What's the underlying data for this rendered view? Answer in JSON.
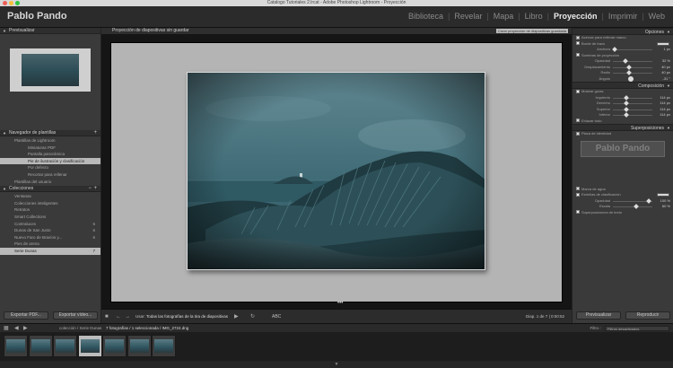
{
  "window": {
    "title": "Catalogo Tutoriales 2.lrcat - Adobe Photoshop Lightroom - Proyección",
    "close_color": "#ee5f57",
    "min_color": "#f6be3b",
    "max_color": "#30c441"
  },
  "identity": "Pablo Pando",
  "modules": [
    {
      "label": "Biblioteca",
      "active": false
    },
    {
      "label": "Revelar",
      "active": false
    },
    {
      "label": "Mapa",
      "active": false
    },
    {
      "label": "Libro",
      "active": false
    },
    {
      "label": "Proyección",
      "active": true
    },
    {
      "label": "Imprimir",
      "active": false
    },
    {
      "label": "Web",
      "active": false
    }
  ],
  "left": {
    "preview_title": "Previsualizar",
    "templates_title": "Navegador de plantillas",
    "templates": [
      {
        "label": "Plantillas de Lightroom",
        "level": 0,
        "selected": false
      },
      {
        "label": "Miniaturas PDF",
        "level": 2,
        "selected": false
      },
      {
        "label": "Pantalla panorámica",
        "level": 2,
        "selected": false
      },
      {
        "label": "Pie de ilustración y clasificación",
        "level": 2,
        "selected": true
      },
      {
        "label": "Por defecto",
        "level": 2,
        "selected": false
      },
      {
        "label": "Recortar para rellenar",
        "level": 2,
        "selected": false
      },
      {
        "label": "Plantillas del usuario",
        "level": 0,
        "selected": false
      }
    ],
    "collections_title": "Colecciones",
    "collections": [
      {
        "label": "Ventanas",
        "count": "",
        "selected": false
      },
      {
        "label": "Colecciones inteligentes",
        "count": "",
        "selected": false
      },
      {
        "label": "Retratos",
        "count": "",
        "selected": false
      },
      {
        "label": "Smart Collections",
        "count": "",
        "selected": false
      },
      {
        "label": "Contraluces",
        "count": "6",
        "selected": false
      },
      {
        "label": "Dunas de San Justo",
        "count": "6",
        "selected": false
      },
      {
        "label": "Nuevo Faro de Bravíos y...",
        "count": "6",
        "selected": false
      },
      {
        "label": "Pies de arena",
        "count": "",
        "selected": false
      },
      {
        "label": "Serie Dunas",
        "count": "7",
        "selected": true
      }
    ],
    "export_pdf": "Exportar PDF...",
    "export_video": "Exportar vídeo..."
  },
  "main": {
    "header": "Proyección de diapositivas sin guardar",
    "header_right": "Crear proyección de diapositivas guardada",
    "dots": "•••",
    "toolbar": {
      "use_label": "Usar:",
      "use_value": "Todas las fotografías de la tira de diapositivas",
      "abc": "ABC",
      "slide_info": "Diap. 1 de 7 | 0:00:52"
    }
  },
  "right": {
    "options_title": "Opciones",
    "options_rows": [
      {
        "type": "check",
        "label": "Acercar para rellenar marco",
        "checked": false
      },
      {
        "type": "check",
        "label": "Borde de trazo",
        "checked": true,
        "swatch": "#d8d8d8"
      },
      {
        "type": "slider",
        "label": "Anchura",
        "value": "1 px",
        "pos": 0.05
      },
      {
        "type": "check",
        "label": "Sombras de proyección",
        "checked": true
      },
      {
        "type": "slider",
        "label": "Opacidad",
        "value": "32 %",
        "pos": 0.32
      },
      {
        "type": "slider",
        "label": "Desplazamiento",
        "value": "40 px",
        "pos": 0.4
      },
      {
        "type": "slider",
        "label": "Radio",
        "value": "40 px",
        "pos": 0.4
      },
      {
        "type": "dial",
        "label": "Ángulo",
        "value": "-31 °"
      }
    ],
    "layout_title": "Composición",
    "layout_rows": [
      {
        "type": "check",
        "label": "Mostrar guías",
        "checked": true
      },
      {
        "type": "slider",
        "label": "Izquierdo",
        "value": "114 px",
        "pos": 0.35
      },
      {
        "type": "slider",
        "label": "Derecho",
        "value": "114 px",
        "pos": 0.35
      },
      {
        "type": "slider",
        "label": "Superior",
        "value": "114 px",
        "pos": 0.35
      },
      {
        "type": "slider",
        "label": "Inferior",
        "value": "114 px",
        "pos": 0.35
      },
      {
        "type": "check",
        "label": "Enlazar todo",
        "checked": false
      }
    ],
    "overlays_title": "Superposiciones",
    "identity_check": "Placa de identidad",
    "identity_plate_text": "Pablo Pando",
    "overlay_rows": [
      {
        "type": "check",
        "label": "Marca de agua",
        "checked": false
      },
      {
        "type": "check",
        "label": "Estrellas de clasificación",
        "checked": true,
        "swatch": "#d8d8d8"
      },
      {
        "type": "slider",
        "label": "Opacidad",
        "value": "100 %",
        "pos": 0.9
      },
      {
        "type": "slider",
        "label": "Escala",
        "value": "60 %",
        "pos": 0.6
      },
      {
        "type": "check",
        "label": "Superposiciones de texto",
        "checked": true
      }
    ],
    "preview_button": "Previsualizar",
    "play_button": "Reproducir"
  },
  "filmbar": {
    "source": "colección / Serie Dunas",
    "count": "7 fotografías / 1 seleccionada / IMG_2724.dng",
    "filter_label": "Filtro :",
    "filter_value": "Filtros desactivados"
  },
  "filmstrip": {
    "thumbs": [
      {
        "label": "Miniatura 1",
        "active": false
      },
      {
        "label": "Miniatura 2",
        "active": false
      },
      {
        "label": "Miniatura 3",
        "active": false
      },
      {
        "label": "Miniatura 4",
        "active": true
      },
      {
        "label": "Miniatura 5",
        "active": false
      },
      {
        "label": "Miniatura 6",
        "active": false
      },
      {
        "label": "Miniatura 7",
        "active": false
      }
    ]
  }
}
